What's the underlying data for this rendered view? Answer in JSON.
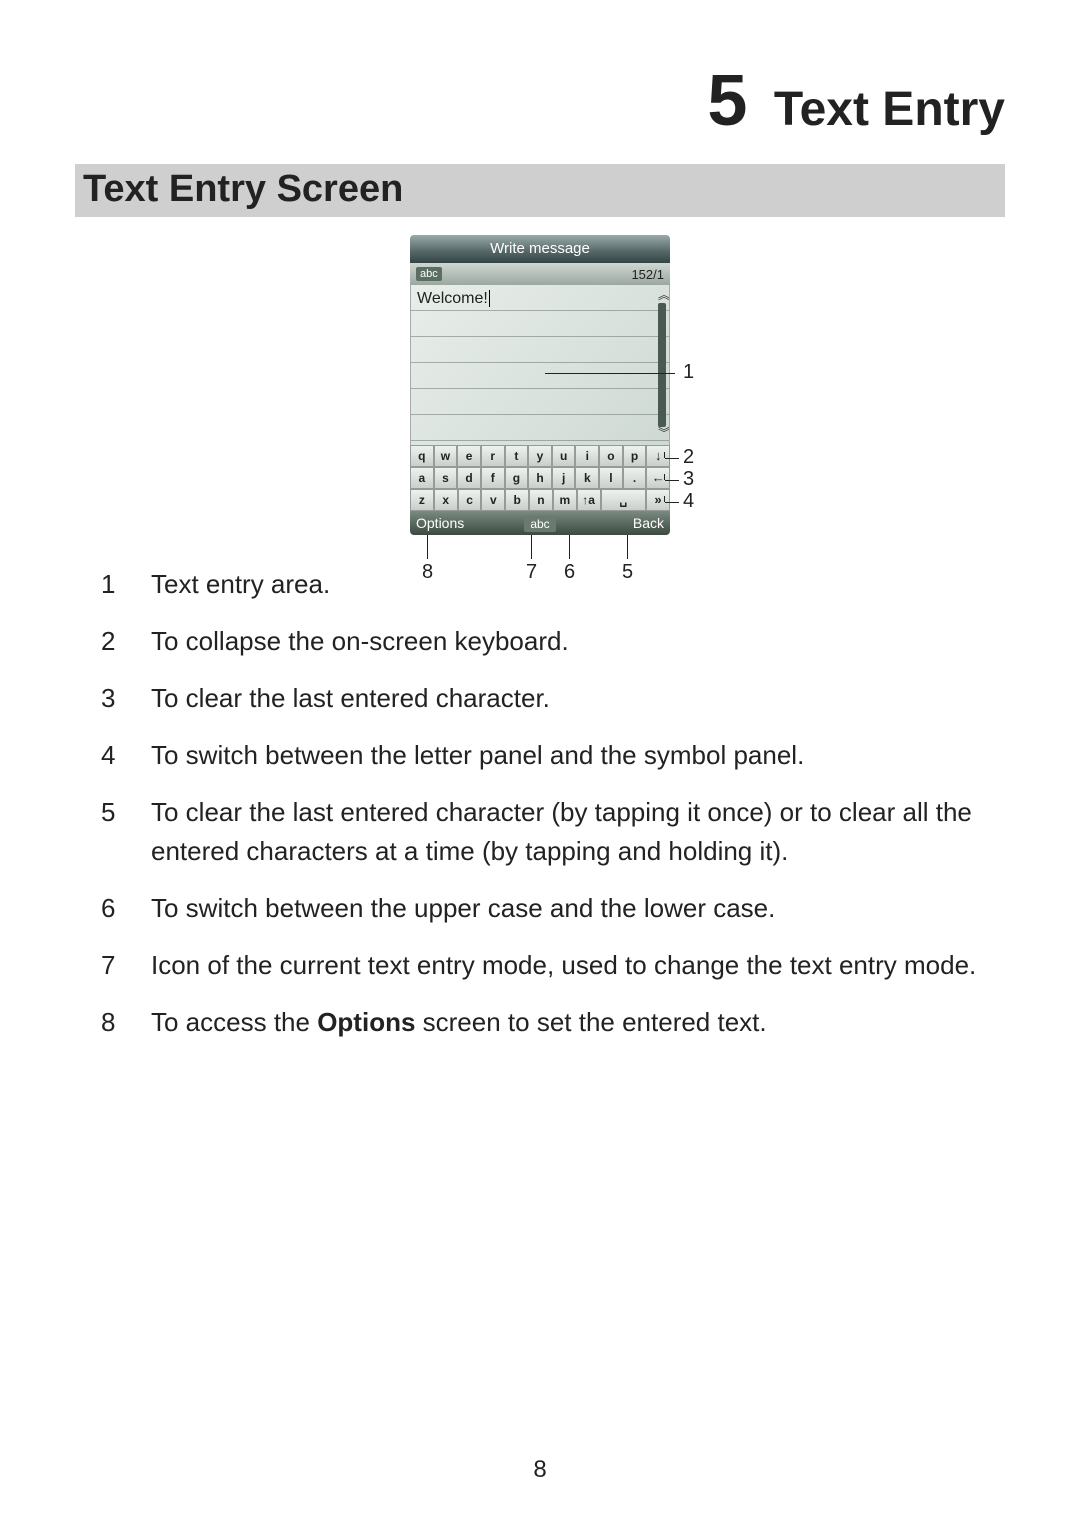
{
  "chapter": {
    "number": "5",
    "title": "Text Entry"
  },
  "section": {
    "title": "Text Entry Screen"
  },
  "phone": {
    "titlebar": "Write message",
    "mode_badge": "abc",
    "counter": "152/1",
    "entered_text": "Welcome!",
    "keys_row1": [
      "q",
      "w",
      "e",
      "r",
      "t",
      "y",
      "u",
      "i",
      "o",
      "p",
      "↓"
    ],
    "keys_row2": [
      "a",
      "s",
      "d",
      "f",
      "g",
      "h",
      "j",
      "k",
      "l",
      ".",
      "←"
    ],
    "keys_row3": [
      "z",
      "x",
      "c",
      "v",
      "b",
      "n",
      "m",
      "↑a",
      "␣",
      "»"
    ],
    "softkeys": {
      "left": "Options",
      "mid": "abc",
      "right": "Back"
    }
  },
  "callout_labels": {
    "c1": "1",
    "c2": "2",
    "c3": "3",
    "c4": "4",
    "c5": "5",
    "c6": "6",
    "c7": "7",
    "c8": "8"
  },
  "legend": [
    {
      "n": "1",
      "text": "Text entry area."
    },
    {
      "n": "2",
      "text": "To collapse the on-screen keyboard."
    },
    {
      "n": "3",
      "text": "To clear the last entered character."
    },
    {
      "n": "4",
      "text": "To switch between the letter panel and the symbol panel."
    },
    {
      "n": "5",
      "text": "To clear the last entered character (by tapping it once) or to clear all the entered characters at a time (by tapping and holding it)."
    },
    {
      "n": "6",
      "text": "To switch between the upper case and the lower case."
    },
    {
      "n": "7",
      "text": "Icon of the current text entry mode, used to change the text entry mode."
    },
    {
      "n": "8",
      "text_pre": "To access the ",
      "text_bold": "Options",
      "text_post": " screen to set the entered text."
    }
  ],
  "page_number": "8"
}
